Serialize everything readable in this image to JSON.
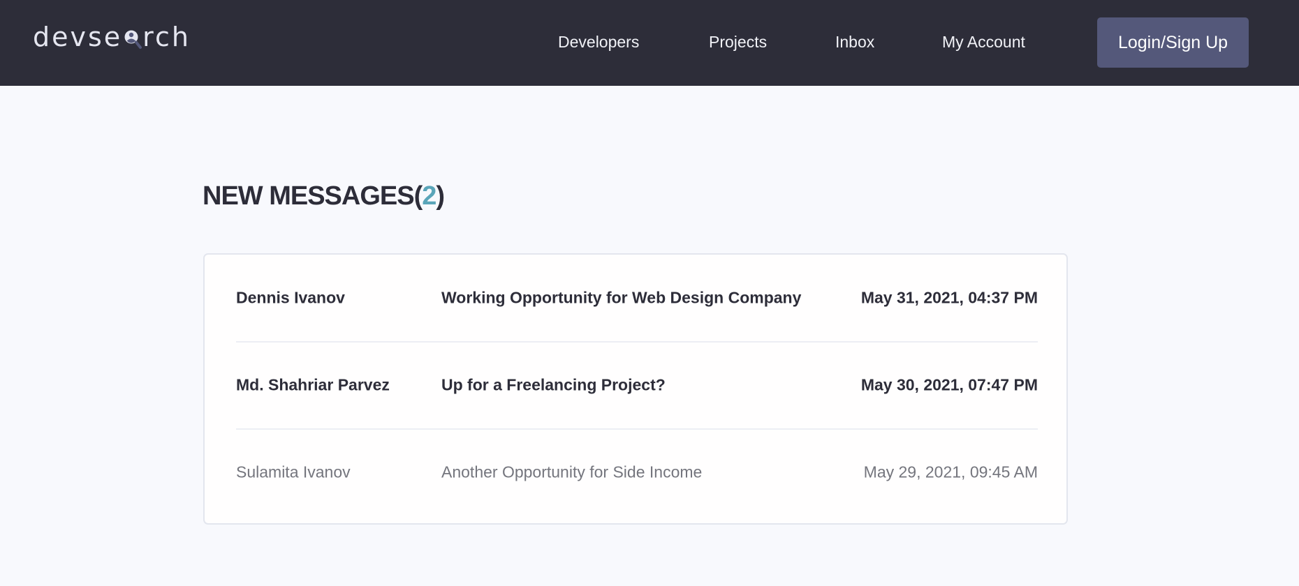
{
  "header": {
    "logo": {
      "text_before": "devse",
      "text_after": "rch",
      "icon": "magnifier-user-icon"
    },
    "nav": [
      {
        "label": "Developers"
      },
      {
        "label": "Projects"
      },
      {
        "label": "Inbox"
      },
      {
        "label": "My Account"
      }
    ],
    "login_label": "Login/Sign Up"
  },
  "main": {
    "title": "NEW MESSAGES",
    "title_open": "(",
    "unread_count": "2",
    "title_close": ")",
    "messages": [
      {
        "sender": "Dennis Ivanov",
        "subject": "Working Opportunity for Web Design Company",
        "date": "May 31, 2021, 04:37 PM",
        "unread": true
      },
      {
        "sender": "Md. Shahriar Parvez",
        "subject": "Up for a Freelancing Project?",
        "date": "May 30, 2021, 07:47 PM",
        "unread": true
      },
      {
        "sender": "Sulamita Ivanov",
        "subject": "Another Opportunity for Side Income",
        "date": "May 29, 2021, 09:45 AM",
        "unread": false
      }
    ]
  },
  "colors": {
    "header_bg": "#2d2d39",
    "page_bg": "#f8f9fd",
    "accent": "#5aa5b9",
    "button_bg": "#54587a",
    "read_text": "#74757d"
  }
}
